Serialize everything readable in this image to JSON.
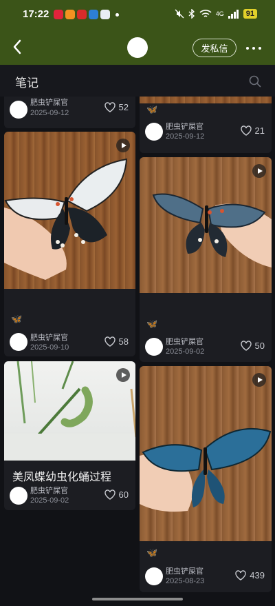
{
  "status_bar": {
    "time": "17:22",
    "battery": "91",
    "network": "4G"
  },
  "nav": {
    "dm_label": "发私信"
  },
  "section": {
    "title": "笔记"
  },
  "cards": {
    "c0": {
      "author": "肥虫铲屎官",
      "date": "2025-09-12",
      "likes": "52"
    },
    "c1": {
      "author": "肥虫铲屎官",
      "date": "2025-09-12",
      "likes": "21"
    },
    "c2": {
      "author": "肥虫铲屎官",
      "date": "2025-09-10",
      "likes": "58"
    },
    "c3": {
      "author": "肥虫铲屎官",
      "date": "2025-09-02",
      "likes": "50"
    },
    "c4": {
      "title": "美凤蝶幼虫化蛹过程",
      "author": "肥虫铲屎官",
      "date": "2025-09-02",
      "likes": "60"
    },
    "c5": {
      "author": "肥虫铲屎官",
      "date": "2025-08-23",
      "likes": "439"
    }
  },
  "colors": {
    "header_green": "#3b5418",
    "background": "#111216",
    "card": "#1c1d22"
  }
}
